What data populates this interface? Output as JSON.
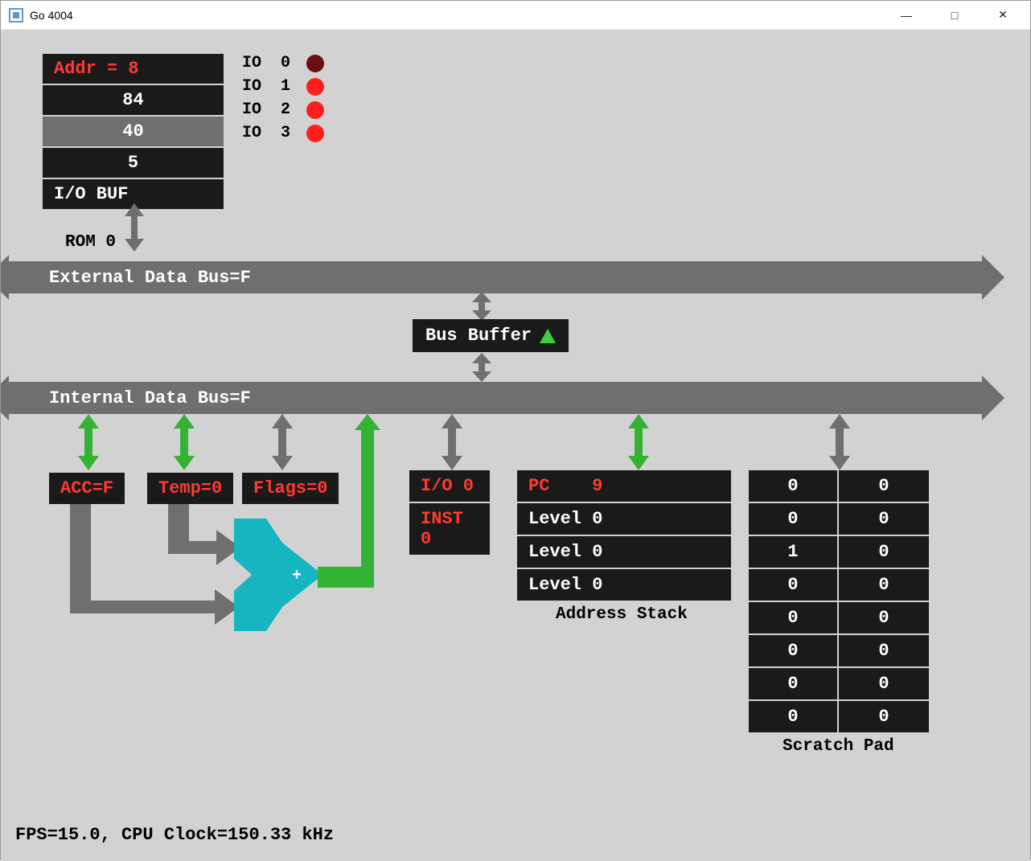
{
  "window": {
    "title": "Go 4004"
  },
  "rom": {
    "addr_label": "Addr = 8",
    "rows": [
      "84",
      "40",
      "5"
    ],
    "highlight_index": 1,
    "iobuf_label": "I/O BUF",
    "name": "ROM 0"
  },
  "io": [
    {
      "label": "IO  0",
      "on": false
    },
    {
      "label": "IO  1",
      "on": true
    },
    {
      "label": "IO  2",
      "on": true
    },
    {
      "label": "IO  3",
      "on": true
    }
  ],
  "external_bus": "External Data Bus=F",
  "bus_buffer": "Bus Buffer",
  "internal_bus": "Internal Data Bus=F",
  "regs": {
    "acc": "ACC=F",
    "temp": "Temp=0",
    "flags": "Flags=0",
    "io": "I/O 0",
    "inst": "INST 0"
  },
  "addr_stack": {
    "rows": [
      "PC    9",
      "Level 0",
      "Level 0",
      "Level 0"
    ],
    "label": "Address Stack"
  },
  "scratch": {
    "rows": [
      [
        "0",
        "0"
      ],
      [
        "0",
        "0"
      ],
      [
        "1",
        "0"
      ],
      [
        "0",
        "0"
      ],
      [
        "0",
        "0"
      ],
      [
        "0",
        "0"
      ],
      [
        "0",
        "0"
      ],
      [
        "0",
        "0"
      ]
    ],
    "label": "Scratch Pad"
  },
  "footer": "FPS=15.0, CPU Clock=150.33 kHz",
  "colors": {
    "green": "#34b233",
    "gray": "#6f6f6f"
  }
}
